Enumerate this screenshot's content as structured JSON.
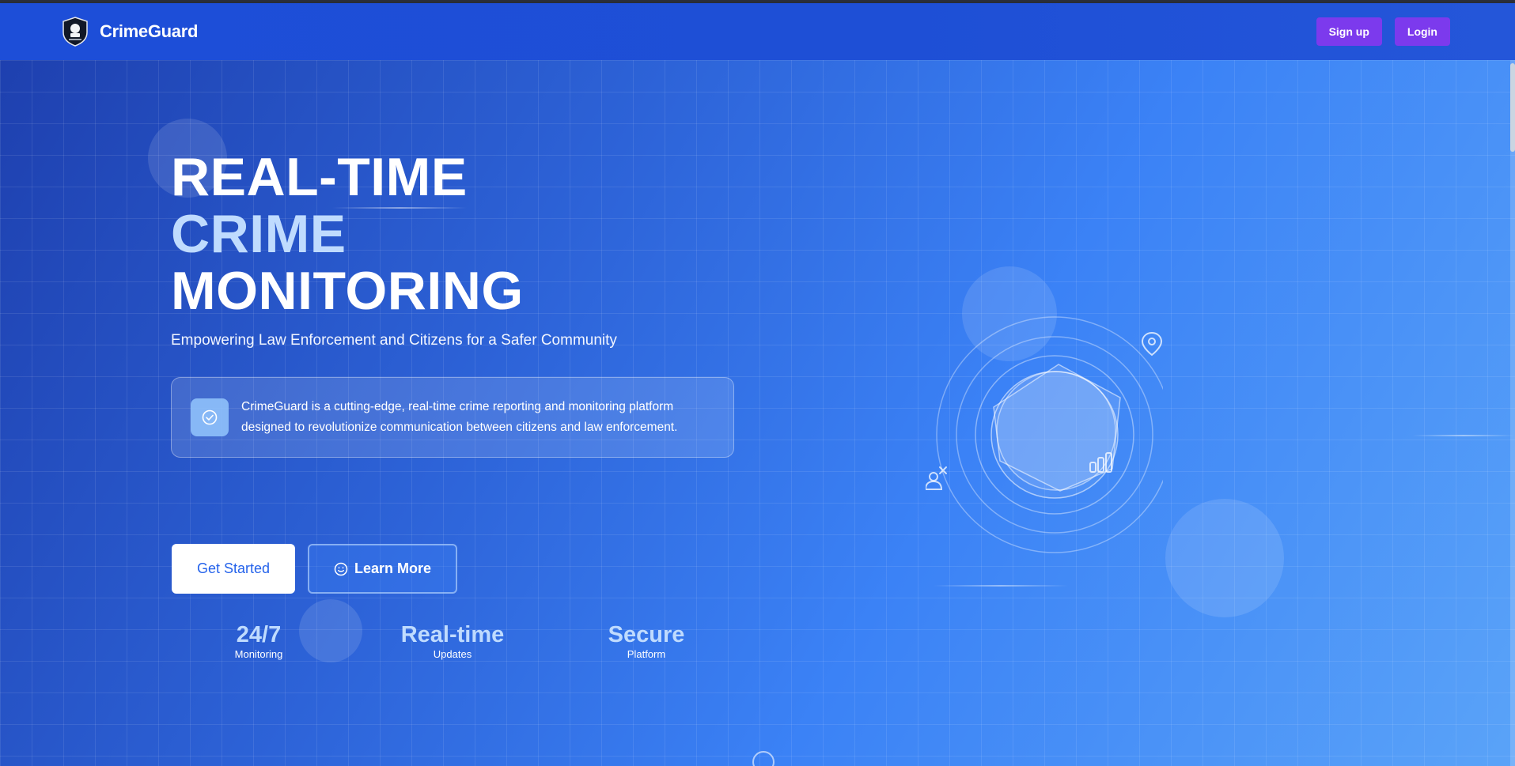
{
  "header": {
    "brand_name": "CrimeGuard",
    "signup_label": "Sign up",
    "login_label": "Login"
  },
  "hero": {
    "title_line1": "REAL-TIME",
    "title_line2": "CRIME",
    "title_line3": "MONITORING",
    "subtitle": "Empowering Law Enforcement and Citizens for a Safer Community",
    "description": "CrimeGuard is a cutting-edge, real-time crime reporting and monitoring platform designed to revolutionize communication between citizens and law enforcement.",
    "get_started_label": "Get Started",
    "learn_more_label": "Learn More"
  },
  "stats": [
    {
      "value": "24/7",
      "label": "Monitoring"
    },
    {
      "value": "Real-time",
      "label": "Updates"
    },
    {
      "value": "Secure",
      "label": "Platform"
    }
  ],
  "icons": {
    "logo": "police-shield-logo",
    "info": "check-circle-icon",
    "learn_more": "smile-icon",
    "illustration": [
      "location-pin-icon",
      "bar-chart-icon",
      "user-alert-icon"
    ]
  },
  "colors": {
    "navbar": "#1d4ed8",
    "nav_button": "#7c3aed",
    "accent_text": "#bfdbfe",
    "primary_button_text": "#2563eb"
  }
}
